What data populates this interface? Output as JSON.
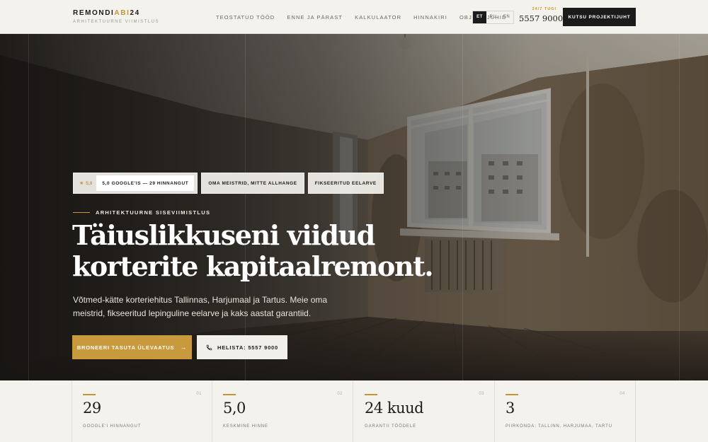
{
  "brand": {
    "name_part1": "REMONDI",
    "name_accent": "ABI",
    "name_part2": "24",
    "tagline": "ARHITEKTUURNE VIIMISTLUS"
  },
  "nav": {
    "items": [
      {
        "label": "TEOSTATUD TÖÖD"
      },
      {
        "label": "ENNE JA PÄRAST"
      },
      {
        "label": "KALKULAATOR"
      },
      {
        "label": "HINNAKIRI"
      },
      {
        "label": "OBJEKTIJUHID"
      }
    ]
  },
  "languages": {
    "items": [
      {
        "label": "ET",
        "active": true
      },
      {
        "label": "RU",
        "active": false
      },
      {
        "label": "EN",
        "active": false
      }
    ]
  },
  "support": {
    "label": "24/7 TUGI",
    "phone": "5557 9000"
  },
  "header_cta": "KUTSU PROJEKTIJUHT",
  "hero": {
    "rating_score": "5,0",
    "rating_text": "5,0 GOOGLE'IS — 29 HINNANGUT",
    "badge_1": "OMA MEISTRID, MITTE ALLHANGE",
    "badge_2": "FIKSEERITUD EELARVE",
    "eyebrow": "ARHITEKTUURNE SISEVIIMISTLUS",
    "headline_line1": "Täiuslikkuseni viidud",
    "headline_line2": "korterite kapitaalremont.",
    "subtitle": "Võtmed-kätte korteriehitus Tallinnas, Harjumaal ja Tartus. Meie oma meistrid, fikseeritud lepinguline eelarve ja kaks aastat garantiid.",
    "primary_button": "BRONEERI TASUTA ÜLEVAATUS",
    "secondary_button": "HELISTA: 5557 9000"
  },
  "stats": [
    {
      "index": "01",
      "value": "29",
      "label": "GOOGLE'I HINNANGUT"
    },
    {
      "index": "02",
      "value": "5,0",
      "label": "KESKMINE HINNE"
    },
    {
      "index": "03",
      "value": "24 kuud",
      "label": "GARANTII TÖÖDELE"
    },
    {
      "index": "04",
      "value": "3",
      "label": "PIIRKONDA: TALLINN, HARJUMAA, TARTU"
    }
  ],
  "colors": {
    "accent": "#c49535",
    "dark": "#1b1b1b",
    "background": "#f4f2ed"
  }
}
